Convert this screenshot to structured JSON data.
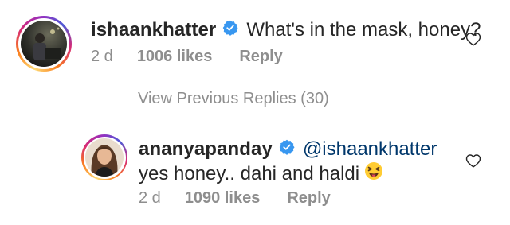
{
  "comments": [
    {
      "username": "ishaankhatter",
      "text": "What's in the mask, honey?",
      "time": "2 d",
      "likes": "1006 likes",
      "reply_label": "Reply"
    }
  ],
  "view_previous": {
    "label": "View Previous Replies (30)"
  },
  "replies": [
    {
      "username": "ananyapanday",
      "mention": "@ishaankhatter",
      "text": "yes honey.. dahi and haldi",
      "emoji": "😝",
      "time": "2 d",
      "likes": "1090 likes",
      "reply_label": "Reply"
    }
  ],
  "colors": {
    "verified_badge": "#3897f0",
    "mention": "#00376b",
    "meta_text": "#8e8e8e",
    "text": "#262626"
  },
  "icons": {
    "verified": "verified-badge-icon",
    "like": "heart-outline-icon"
  }
}
